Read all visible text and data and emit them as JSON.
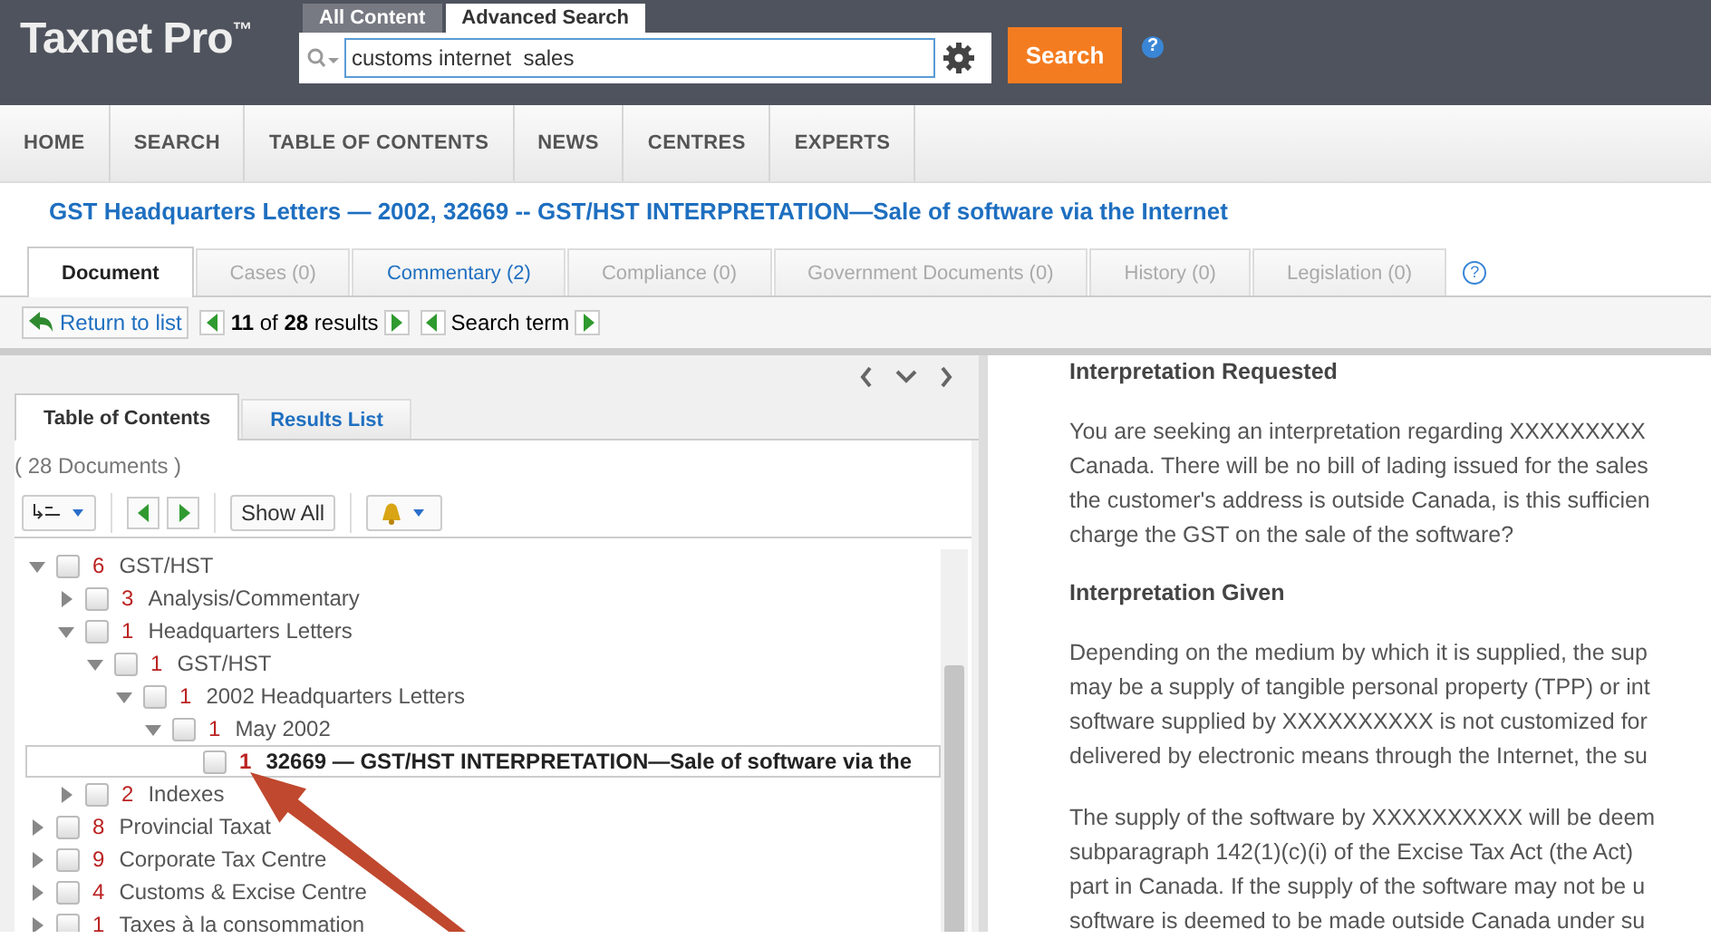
{
  "logo": {
    "name": "Taxnet Pro",
    "mark": "™"
  },
  "search": {
    "scopes": [
      {
        "label": "All Content",
        "selected": false
      },
      {
        "label": "Advanced Search",
        "selected": true
      }
    ],
    "value": "customs internet  sales",
    "button": "Search",
    "help": "?"
  },
  "nav": [
    {
      "label": "HOME"
    },
    {
      "label": "SEARCH"
    },
    {
      "label": "TABLE OF CONTENTS"
    },
    {
      "label": "NEWS"
    },
    {
      "label": "CENTRES"
    },
    {
      "label": "EXPERTS"
    }
  ],
  "document_title": "GST Headquarters Letters — 2002, 32669 -- GST/HST INTERPRETATION—Sale of software via the Internet",
  "doc_tabs": [
    {
      "label": "Document",
      "selected": true,
      "disabled": false
    },
    {
      "label": "Cases (0)",
      "selected": false,
      "disabled": true
    },
    {
      "label": "Commentary (2)",
      "selected": false,
      "disabled": false
    },
    {
      "label": "Compliance (0)",
      "selected": false,
      "disabled": true
    },
    {
      "label": "Government Documents (0)",
      "selected": false,
      "disabled": true
    },
    {
      "label": "History (0)",
      "selected": false,
      "disabled": true
    },
    {
      "label": "Legislation (0)",
      "selected": false,
      "disabled": true
    }
  ],
  "doc_tabs_help": "?",
  "result_nav": {
    "return": "Return to list",
    "current": "11",
    "of": "of",
    "total": "28",
    "results": "results",
    "search_term": "Search term"
  },
  "left_panel": {
    "tabs": [
      {
        "label": "Table of Contents",
        "selected": true
      },
      {
        "label": "Results List",
        "selected": false
      }
    ],
    "count": "( 28 Documents )",
    "show_all": "Show All",
    "tree": [
      {
        "count": "6",
        "label": "GST/HST",
        "expanded": true,
        "checked": false,
        "selected": false,
        "children": [
          {
            "count": "3",
            "label": "Analysis/Commentary",
            "expanded": false,
            "checked": false,
            "selected": false
          },
          {
            "count": "1",
            "label": "Headquarters Letters",
            "expanded": true,
            "checked": false,
            "selected": false,
            "children": [
              {
                "count": "1",
                "label": "GST/HST",
                "expanded": true,
                "checked": false,
                "selected": false,
                "children": [
                  {
                    "count": "1",
                    "label": "2002 Headquarters Letters",
                    "expanded": true,
                    "checked": false,
                    "selected": false,
                    "children": [
                      {
                        "count": "1",
                        "label": "May 2002",
                        "expanded": true,
                        "checked": false,
                        "selected": false,
                        "children": [
                          {
                            "count": "1",
                            "label": "32669 — GST/HST INTERPRETATION—Sale of software via the",
                            "checked": false,
                            "selected": true
                          }
                        ]
                      }
                    ]
                  }
                ]
              }
            ]
          },
          {
            "count": "2",
            "label": "Indexes",
            "expanded": false,
            "checked": false,
            "selected": false
          }
        ]
      },
      {
        "count": "8",
        "label": "Provincial Taxat",
        "expanded": false,
        "checked": false,
        "selected": false
      },
      {
        "count": "9",
        "label": "Corporate Tax Centre",
        "expanded": false,
        "checked": false,
        "selected": false
      },
      {
        "count": "4",
        "label": "Customs & Excise Centre",
        "expanded": false,
        "checked": false,
        "selected": false
      },
      {
        "count": "1",
        "label": "Taxes à la consommation",
        "expanded": false,
        "checked": false,
        "selected": false
      }
    ]
  },
  "document": [
    {
      "kind": "heading",
      "text": "Interpretation Requested"
    },
    {
      "kind": "paragraph",
      "lines": [
        "You are seeking an interpretation regarding XXXXXXXXX",
        "Canada. There will be no bill of lading issued for the sales",
        "the customer's address is outside Canada, is this sufficien",
        "charge the GST on the sale of the software?"
      ]
    },
    {
      "kind": "heading",
      "text": "Interpretation Given"
    },
    {
      "kind": "paragraph",
      "lines": [
        "Depending on the medium by which it is supplied, the sup",
        "may be a supply of tangible personal property (TPP) or int",
        "software supplied by XXXXXXXXXX is not customized for",
        "delivered by electronic means through the Internet, the su"
      ]
    },
    {
      "kind": "paragraph",
      "lines": [
        "The supply of the software by XXXXXXXXXX will be deem",
        "subparagraph 142(1)(c)(i) of the Excise Tax Act (the Act)",
        "part in Canada. If the supply of the software may not be u",
        "software is deemed to be made outside Canada under su"
      ]
    }
  ]
}
